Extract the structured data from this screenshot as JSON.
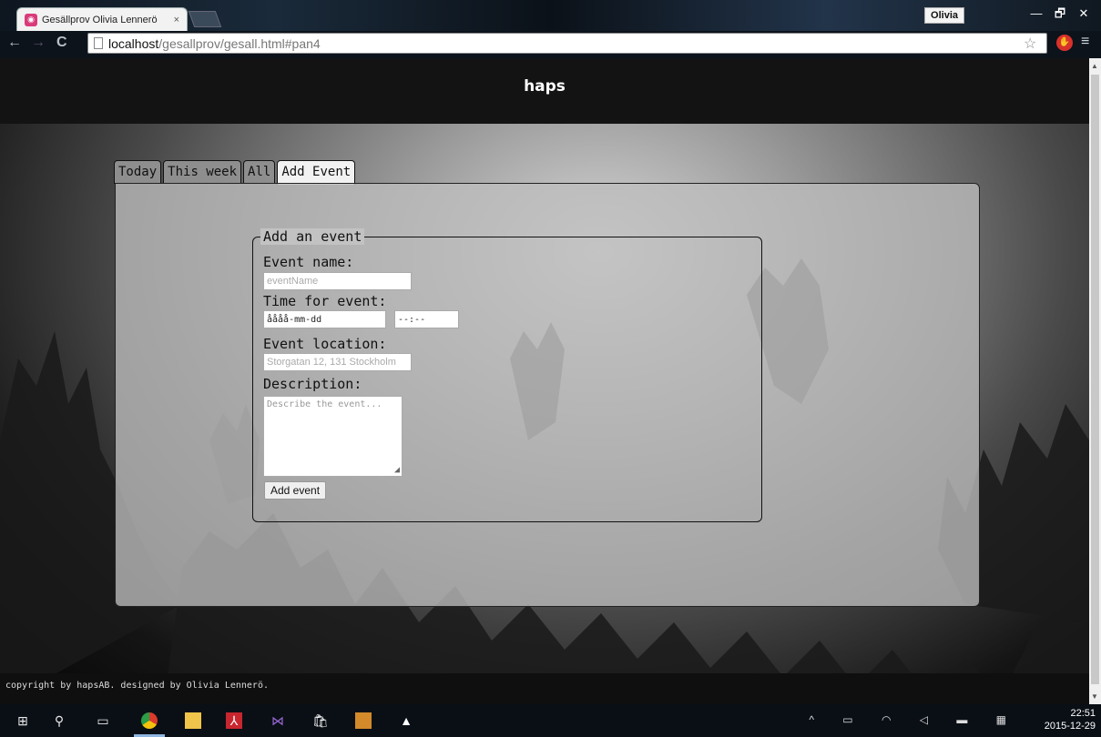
{
  "browser": {
    "tab_title": "Gesällprov Olivia Lennerö",
    "tab_close": "×",
    "url_host": "localhost",
    "url_path": "/gesallprov/gesall.html#pan4",
    "user_name": "Olivia",
    "win_minimize": "—",
    "win_restore": "🗗",
    "win_close": "✕",
    "back": "←",
    "forward": "→",
    "reload": "C",
    "star": "☆",
    "menu": "≡"
  },
  "site": {
    "header_title": "haps",
    "tabs": [
      {
        "label": "Today"
      },
      {
        "label": "This week"
      },
      {
        "label": "All"
      },
      {
        "label": "Add Event"
      }
    ],
    "form": {
      "legend": "Add an event",
      "event_name_label": "Event name:",
      "event_name_placeholder": "eventName",
      "time_label": "Time for event:",
      "date_value": "åååå-mm-dd",
      "time_value": "--:--",
      "location_label": "Event location:",
      "location_placeholder": "Storgatan 12, 131 Stockholm",
      "description_label": "Description:",
      "description_placeholder": "Describe the event...",
      "submit_label": "Add event"
    },
    "footer_text": "copyright by hapsAB. designed by Olivia Lennerö."
  },
  "taskbar": {
    "clock_time": "22:51",
    "clock_date": "2015-12-29"
  },
  "colors": {
    "header_bg": "#131313",
    "panel_bg": "#bebebe",
    "active_tab": "#f2f2f2",
    "inactive_tab": "#8e8e8e"
  },
  "icons": [
    "chrome-favicon",
    "page-icon",
    "star-icon",
    "adblock-icon",
    "menu-icon",
    "windows-start-icon",
    "search-icon",
    "task-view-icon",
    "chrome-icon",
    "file-explorer-icon",
    "acrobat-icon",
    "visual-studio-icon",
    "store-icon",
    "app-icon",
    "photos-icon"
  ]
}
